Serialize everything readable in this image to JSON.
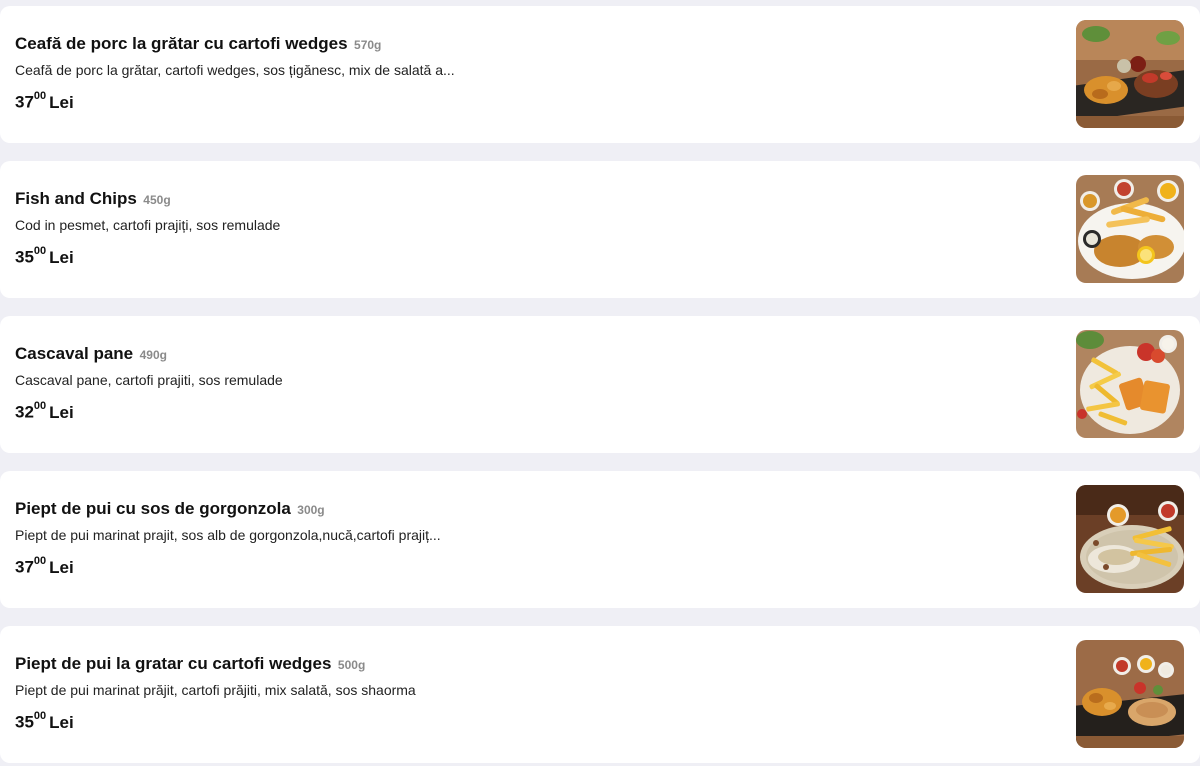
{
  "items": [
    {
      "title": "Ceafă de porc la grătar cu cartofi wedges",
      "weight": "570g",
      "description": "Ceafă de porc la grătar, cartofi wedges, sos țigănesc, mix de salată a...",
      "price_int": "37",
      "price_dec": "00",
      "currency": "Lei",
      "image_icon": "pork-neck-dish-photo"
    },
    {
      "title": "Fish and Chips",
      "weight": "450g",
      "description": "Cod in pesmet, cartofi prajiți, sos remulade",
      "price_int": "35",
      "price_dec": "00",
      "currency": "Lei",
      "image_icon": "fish-and-chips-photo"
    },
    {
      "title": "Cascaval pane",
      "weight": "490g",
      "description": "Cascaval pane, cartofi prajiti, sos remulade",
      "price_int": "32",
      "price_dec": "00",
      "currency": "Lei",
      "image_icon": "cascaval-pane-photo"
    },
    {
      "title": "Piept de pui cu sos de gorgonzola",
      "weight": "300g",
      "description": "Piept de pui marinat prajit, sos alb de gorgonzola,nucă,cartofi prajiț...",
      "price_int": "37",
      "price_dec": "00",
      "currency": "Lei",
      "image_icon": "chicken-gorgonzola-photo"
    },
    {
      "title": "Piept de pui la gratar cu cartofi wedges",
      "weight": "500g",
      "description": "Piept de pui marinat prăjit, cartofi prăjiti, mix salată, sos shaorma",
      "price_int": "35",
      "price_dec": "00",
      "currency": "Lei",
      "image_icon": "grilled-chicken-wedges-photo"
    }
  ],
  "colors": {
    "page_background": "#efeff5",
    "card_background": "#ffffff",
    "title": "#111111",
    "weight": "#8a8a8a"
  }
}
